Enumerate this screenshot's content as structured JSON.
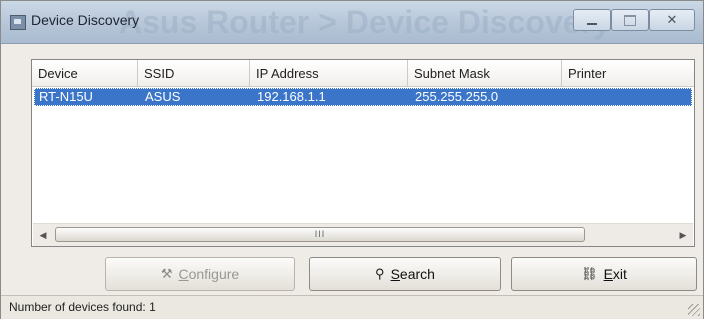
{
  "window": {
    "title": "Device Discovery",
    "background_title": "Asus Router > Device Discovery",
    "controls": {
      "minimize": "–",
      "maximize": "□",
      "close": "✕"
    }
  },
  "table": {
    "columns": [
      "Device",
      "SSID",
      "IP Address",
      "Subnet Mask",
      "Printer"
    ],
    "rows": [
      {
        "device": "RT-N15U",
        "ssid": "ASUS",
        "ip": "192.168.1.1",
        "subnet": "255.255.255.0",
        "printer": "",
        "selected": true
      }
    ],
    "scroll_thumb_grip": "III"
  },
  "buttons": {
    "configure": {
      "label_rest": "onfigure",
      "mnemonic": "C",
      "enabled": false
    },
    "search": {
      "label_rest": "earch",
      "mnemonic": "S",
      "enabled": true
    },
    "exit": {
      "label_rest": "xit",
      "mnemonic": "E",
      "enabled": true
    }
  },
  "status": {
    "text": "Number of devices found: 1"
  },
  "colors": {
    "selection": "#3a75c9",
    "titlebar": "#b6c6d8",
    "background": "#efebe6"
  },
  "icons": {
    "app": "app-icon",
    "configure": "configure-icon",
    "search": "search-icon",
    "exit": "exit-icon"
  }
}
